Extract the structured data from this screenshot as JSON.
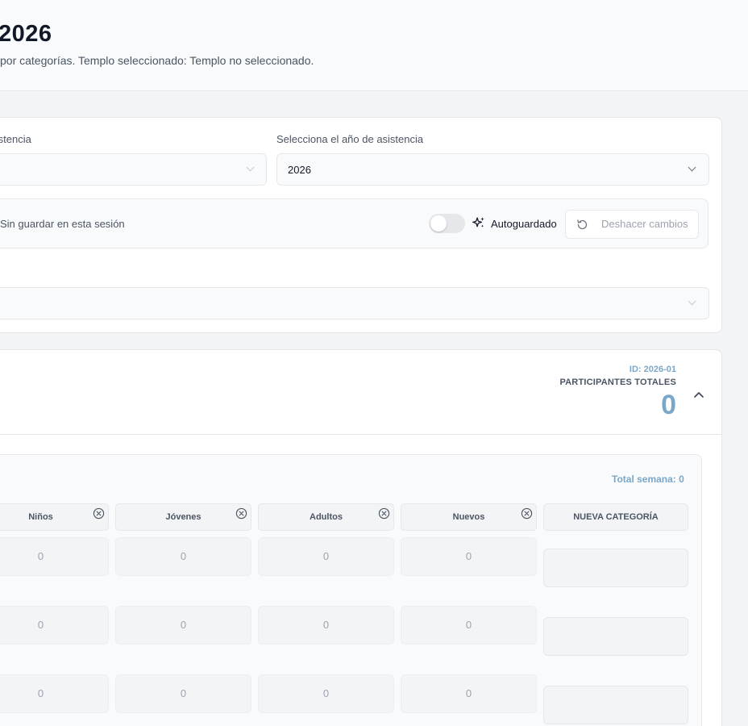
{
  "header": {
    "title": "2026",
    "subtitle": "por categorías. Templo seleccionado: Templo no seleccionado."
  },
  "filters": {
    "week_label": "asistencia",
    "week_value": "",
    "year_label": "Selecciona el año de asistencia",
    "year_value": "2026",
    "third_select_value": ""
  },
  "session": {
    "status_text": "Sin guardar en esta sesión",
    "autosave_label": "Autoguardado",
    "autosave_on": false,
    "undo_label": "Deshacer cambios"
  },
  "week": {
    "id_text": "ID: 2026-01",
    "total_label": "PARTICIPANTES TOTALES",
    "total_value": "0",
    "total_semana": "Total semana: 0"
  },
  "categories": [
    {
      "name": "Niños"
    },
    {
      "name": "Jóvenes"
    },
    {
      "name": "Adultos"
    },
    {
      "name": "Nuevos"
    }
  ],
  "new_category_label": "NUEVA CATEGORÍA",
  "rows": [
    [
      "0",
      "0",
      "0",
      "0"
    ],
    [
      "0",
      "0",
      "0",
      "0"
    ],
    [
      "0",
      "0",
      "0",
      "0"
    ]
  ],
  "colors": {
    "accent": "#7aa7c7",
    "border": "#e5e7eb",
    "muted_text": "#9ca3af"
  }
}
